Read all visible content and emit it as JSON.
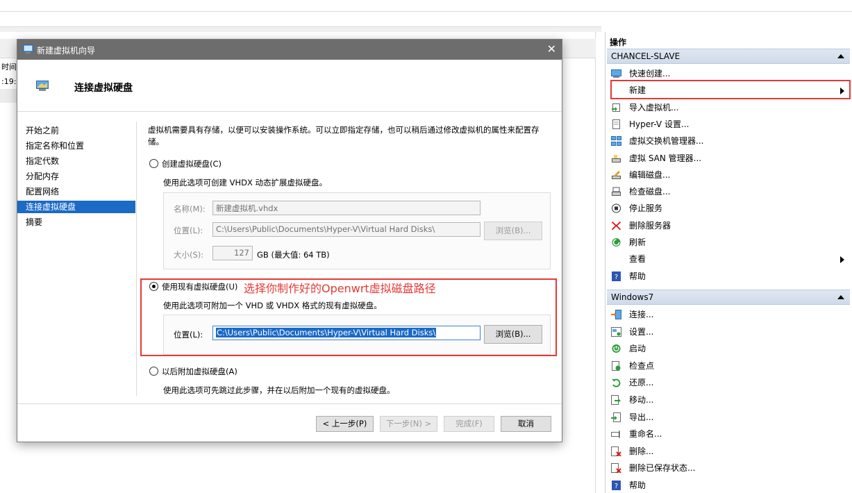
{
  "background": {
    "list_col_time": "时间",
    "list_cell_time": ":19:"
  },
  "actions_pane": {
    "title": "操作",
    "sections": [
      {
        "name": "CHANCEL-SLAVE",
        "items": [
          {
            "label": "快速创建...",
            "icon": "quick-create-icon"
          },
          {
            "label": "新建",
            "icon": "",
            "submenu": true
          },
          {
            "label": "导入虚拟机...",
            "icon": "import-vm-icon"
          },
          {
            "label": "Hyper-V 设置...",
            "icon": "settings-page-icon"
          },
          {
            "label": "虚拟交换机管理器...",
            "icon": "switch-manager-icon"
          },
          {
            "label": "虚拟 SAN 管理器...",
            "icon": "san-manager-icon"
          },
          {
            "label": "编辑磁盘...",
            "icon": "edit-disk-icon"
          },
          {
            "label": "检查磁盘...",
            "icon": "inspect-disk-icon"
          },
          {
            "label": "停止服务",
            "icon": "stop-service-icon"
          },
          {
            "label": "删除服务器",
            "icon": "delete-server-icon"
          },
          {
            "label": "刷新",
            "icon": "refresh-icon"
          },
          {
            "label": "查看",
            "icon": "",
            "submenu": true
          },
          {
            "label": "帮助",
            "icon": "help-icon"
          }
        ]
      },
      {
        "name": "Windows7",
        "items": [
          {
            "label": "连接...",
            "icon": "connect-icon"
          },
          {
            "label": "设置...",
            "icon": "vm-settings-icon"
          },
          {
            "label": "启动",
            "icon": "start-icon"
          },
          {
            "label": "检查点",
            "icon": "checkpoint-icon"
          },
          {
            "label": "还原...",
            "icon": "revert-icon"
          },
          {
            "label": "移动...",
            "icon": "move-icon"
          },
          {
            "label": "导出...",
            "icon": "export-icon"
          },
          {
            "label": "重命名...",
            "icon": "rename-icon"
          },
          {
            "label": "删除...",
            "icon": "delete-icon"
          },
          {
            "label": "删除已保存状态...",
            "icon": "delete-saved-state-icon"
          },
          {
            "label": "帮助",
            "icon": "help-icon"
          }
        ]
      }
    ]
  },
  "dialog": {
    "window_title": "新建虚拟机向导",
    "page_title": "连接虚拟硬盘",
    "nav": [
      "开始之前",
      "指定名称和位置",
      "指定代数",
      "分配内存",
      "配置网络",
      "连接虚拟硬盘",
      "摘要"
    ],
    "nav_selected_index": 5,
    "intro": "虚拟机需要具有存储，以便可以安装操作系统。可以立即指定存储，也可以稍后通过修改虚拟机的属性来配置存储。",
    "option_create": {
      "label": "创建虚拟硬盘(C)",
      "desc": "使用此选项可创建 VHDX 动态扩展虚拟硬盘。",
      "name_label": "名称(M):",
      "name_value": "新建虚拟机.vhdx",
      "location_label": "位置(L):",
      "location_value": "C:\\Users\\Public\\Documents\\Hyper-V\\Virtual Hard Disks\\",
      "browse_label": "浏览(B)...",
      "size_label": "大小(S):",
      "size_value": "127",
      "size_unit": "GB (最大值: 64 TB)"
    },
    "option_existing": {
      "label": "使用现有虚拟硬盘(U)",
      "desc": "使用此选项可附加一个 VHD 或 VHDX 格式的现有虚拟硬盘。",
      "location_label": "位置(L):",
      "location_value": "C:\\Users\\Public\\Documents\\Hyper-V\\Virtual Hard Disks\\",
      "browse_label": "浏览(B)..."
    },
    "annotation": "选择你制作好的Openwrt虚拟磁盘路径",
    "option_later": {
      "label": "以后附加虚拟硬盘(A)",
      "desc": "使用此选项可先跳过此步骤，并在以后附加一个现有的虚拟硬盘。"
    },
    "selected_option": "existing",
    "buttons": {
      "prev": "< 上一步(P)",
      "next": "下一步(N) >",
      "finish": "完成(F)",
      "cancel": "取消"
    }
  }
}
